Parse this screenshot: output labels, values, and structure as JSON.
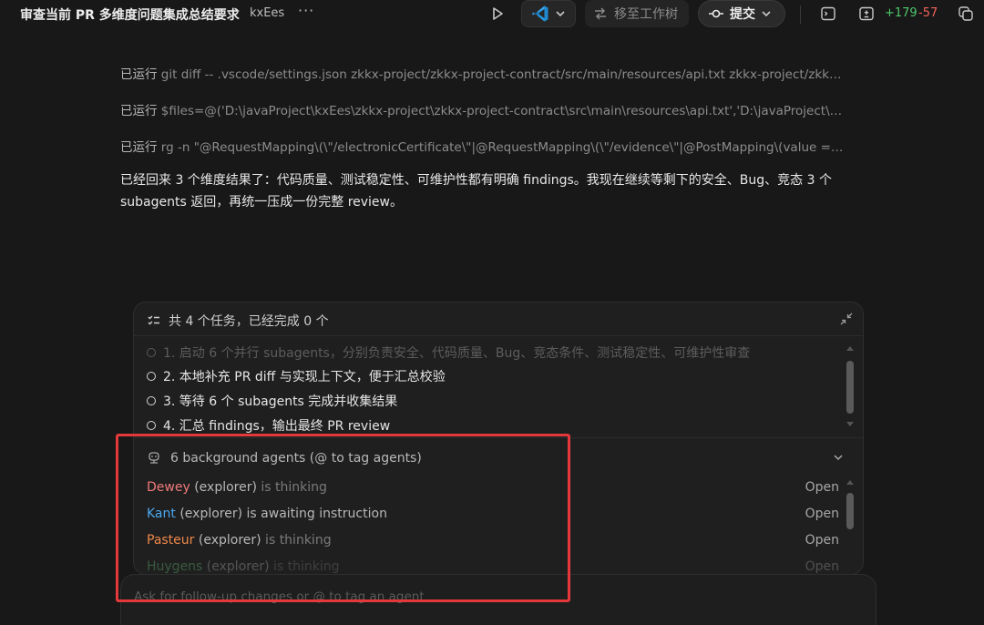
{
  "header": {
    "title": "审查当前 PR 多维度问题集成总结要求",
    "repo": "kxEes",
    "more": "···",
    "worktree_label": "移至工作树",
    "commit_label": "提交",
    "added": "+179",
    "removed": "-57"
  },
  "content": {
    "ran_prefix": "已运行",
    "ran_lines": [
      "git diff -- .vscode/settings.json zkkx-project/zkkx-project-contract/src/main/resources/api.txt zkkx-project/zkkx-pro...",
      "$files=@('D:\\javaProject\\kxEes\\zkkx-project\\zkkx-project-contract\\src\\main\\resources\\api.txt','D:\\javaProject\\kxEes...",
      "rg -n \"@RequestMapping\\(\\\"/electronicCertificate\\\"|@RequestMapping\\(\\\"/evidence\\\"|@PostMapping\\(value = \\\"/..."
    ],
    "summary": "已经回来 3 个维度结果了：代码质量、测试稳定性、可维护性都有明确 findings。我现在继续等剩下的安全、Bug、竞态 3 个 subagents 返回，再统一压成一份完整 review。"
  },
  "tasks": {
    "header": "共 4 个任务，已经完成 0 个",
    "items": [
      "1.  启动 6 个并行 subagents，分别负责安全、代码质量、Bug、竞态条件、测试稳定性、可维护性审查",
      "2.  本地补充 PR diff 与实现上下文，便于汇总校验",
      "3.  等待 6 个 subagents 完成并收集结果",
      "4.  汇总 findings，输出最终 PR review"
    ]
  },
  "agents": {
    "header": "6 background agents (@ to tag agents)",
    "open_label": "Open",
    "items": [
      {
        "name": "Dewey",
        "role": " (explorer)",
        "status": " is thinking",
        "color": "#f07a7a"
      },
      {
        "name": "Kant",
        "role": " (explorer)",
        "status": " is awaiting instruction",
        "color": "#4aa8f0"
      },
      {
        "name": "Pasteur",
        "role": " (explorer)",
        "status": " is thinking",
        "color": "#f0884a"
      },
      {
        "name": "Huygens",
        "role": " (explorer)",
        "status": " is thinking",
        "color": "#6ac97a"
      }
    ]
  },
  "input": {
    "placeholder": "Ask for follow-up changes or @ to tag an agent"
  },
  "colors": {
    "highlight": "#e5383b",
    "added": "#4ec96b",
    "removed": "#f0625a"
  }
}
